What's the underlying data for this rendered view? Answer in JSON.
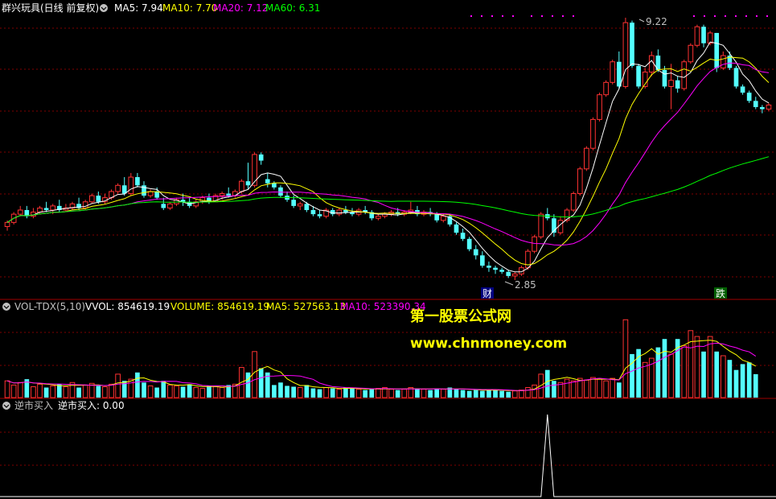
{
  "panels": {
    "main": {
      "title": "群兴玩具(日线 前复权)",
      "indicators": [
        {
          "label": "MA5: 7.94",
          "color": "#ffffff"
        },
        {
          "label": "MA10: 7.70",
          "color": "#ffff00"
        },
        {
          "label": "MA20: 7.12",
          "color": "#ff00ff"
        },
        {
          "label": "MA60: 6.31",
          "color": "#00ff00"
        }
      ],
      "high_label": "9.22",
      "low_label": "2.85",
      "markers": {
        "finance": "财",
        "drop": "跌"
      }
    },
    "volume": {
      "title": "VOL-TDX(5,10)",
      "indicators": [
        {
          "label": "VVOL: 854619.19",
          "color": "#ffffff"
        },
        {
          "label": "VOLUME: 854619.19",
          "color": "#ffff00"
        },
        {
          "label": "MA5: 527563.13",
          "color": "#ffff00"
        },
        {
          "label": "MA10: 523390.34",
          "color": "#ff00ff"
        }
      ]
    },
    "signal": {
      "title": "逆市买入",
      "indicators": [
        {
          "label": "逆市买入: 0.00",
          "color": "#ffffff"
        }
      ]
    }
  },
  "watermark": {
    "line1": "第一股票公式网",
    "line2": "www.chnmoney.com"
  },
  "colors": {
    "up": "#ff3232",
    "down": "#54ffff",
    "ma5": "#ffffff",
    "ma10": "#ffff00",
    "ma20": "#ff00ff",
    "ma60": "#00ff00",
    "grid": "#800000",
    "panel_border": "#a00000",
    "watermark": "#ffff00"
  },
  "chart_data": {
    "type": "candlestick",
    "price_range": [
      2.85,
      9.22
    ],
    "candles": [
      {
        "o": 4.15,
        "h": 4.3,
        "l": 4.05,
        "c": 4.25
      },
      {
        "o": 4.25,
        "h": 4.5,
        "l": 4.2,
        "c": 4.45
      },
      {
        "o": 4.45,
        "h": 4.65,
        "l": 4.4,
        "c": 4.55
      },
      {
        "o": 4.55,
        "h": 4.65,
        "l": 4.35,
        "c": 4.4
      },
      {
        "o": 4.4,
        "h": 4.6,
        "l": 4.35,
        "c": 4.5
      },
      {
        "o": 4.5,
        "h": 4.65,
        "l": 4.45,
        "c": 4.6
      },
      {
        "o": 4.6,
        "h": 4.75,
        "l": 4.5,
        "c": 4.55
      },
      {
        "o": 4.55,
        "h": 4.7,
        "l": 4.45,
        "c": 4.65
      },
      {
        "o": 4.65,
        "h": 4.8,
        "l": 4.5,
        "c": 4.55
      },
      {
        "o": 4.55,
        "h": 4.7,
        "l": 4.5,
        "c": 4.6
      },
      {
        "o": 4.6,
        "h": 4.75,
        "l": 4.55,
        "c": 4.7
      },
      {
        "o": 4.7,
        "h": 4.85,
        "l": 4.55,
        "c": 4.6
      },
      {
        "o": 4.6,
        "h": 4.8,
        "l": 4.55,
        "c": 4.75
      },
      {
        "o": 4.75,
        "h": 4.95,
        "l": 4.7,
        "c": 4.9
      },
      {
        "o": 4.9,
        "h": 5.0,
        "l": 4.7,
        "c": 4.75
      },
      {
        "o": 4.75,
        "h": 4.95,
        "l": 4.7,
        "c": 4.85
      },
      {
        "o": 4.85,
        "h": 5.05,
        "l": 4.8,
        "c": 5.0
      },
      {
        "o": 5.0,
        "h": 5.2,
        "l": 4.95,
        "c": 5.15
      },
      {
        "o": 5.15,
        "h": 5.35,
        "l": 4.9,
        "c": 4.95
      },
      {
        "o": 4.95,
        "h": 5.45,
        "l": 4.9,
        "c": 5.35
      },
      {
        "o": 5.35,
        "h": 5.45,
        "l": 5.1,
        "c": 5.15
      },
      {
        "o": 5.15,
        "h": 5.25,
        "l": 4.85,
        "c": 4.9
      },
      {
        "o": 4.9,
        "h": 5.05,
        "l": 4.85,
        "c": 5.0
      },
      {
        "o": 5.0,
        "h": 5.1,
        "l": 4.8,
        "c": 4.85
      },
      {
        "o": 4.7,
        "h": 4.85,
        "l": 4.55,
        "c": 4.6
      },
      {
        "o": 4.6,
        "h": 4.75,
        "l": 4.55,
        "c": 4.7
      },
      {
        "o": 4.7,
        "h": 4.85,
        "l": 4.65,
        "c": 4.8
      },
      {
        "o": 4.8,
        "h": 4.95,
        "l": 4.65,
        "c": 4.75
      },
      {
        "o": 4.75,
        "h": 4.85,
        "l": 4.6,
        "c": 4.65
      },
      {
        "o": 4.65,
        "h": 4.8,
        "l": 4.6,
        "c": 4.75
      },
      {
        "o": 4.75,
        "h": 4.9,
        "l": 4.7,
        "c": 4.85
      },
      {
        "o": 4.85,
        "h": 4.95,
        "l": 4.7,
        "c": 4.75
      },
      {
        "o": 4.75,
        "h": 4.95,
        "l": 4.75,
        "c": 4.9
      },
      {
        "o": 4.9,
        "h": 5.0,
        "l": 4.8,
        "c": 4.95
      },
      {
        "o": 4.95,
        "h": 5.1,
        "l": 4.85,
        "c": 4.9
      },
      {
        "o": 4.9,
        "h": 5.05,
        "l": 4.85,
        "c": 5.0
      },
      {
        "o": 5.0,
        "h": 5.3,
        "l": 4.95,
        "c": 5.25
      },
      {
        "o": 5.25,
        "h": 5.7,
        "l": 5.05,
        "c": 5.15
      },
      {
        "o": 5.15,
        "h": 5.95,
        "l": 5.1,
        "c": 5.9
      },
      {
        "o": 5.9,
        "h": 5.95,
        "l": 5.65,
        "c": 5.75
      },
      {
        "o": 5.3,
        "h": 5.45,
        "l": 5.1,
        "c": 5.2
      },
      {
        "o": 5.2,
        "h": 5.25,
        "l": 5.05,
        "c": 5.1
      },
      {
        "o": 5.1,
        "h": 5.15,
        "l": 4.85,
        "c": 4.9
      },
      {
        "o": 4.9,
        "h": 5.0,
        "l": 4.75,
        "c": 4.8
      },
      {
        "o": 4.8,
        "h": 4.9,
        "l": 4.6,
        "c": 4.65
      },
      {
        "o": 4.65,
        "h": 4.75,
        "l": 4.55,
        "c": 4.7
      },
      {
        "o": 4.7,
        "h": 4.75,
        "l": 4.5,
        "c": 4.55
      },
      {
        "o": 4.55,
        "h": 4.65,
        "l": 4.4,
        "c": 4.45
      },
      {
        "o": 4.45,
        "h": 4.55,
        "l": 4.35,
        "c": 4.4
      },
      {
        "o": 4.4,
        "h": 4.6,
        "l": 4.35,
        "c": 4.55
      },
      {
        "o": 4.55,
        "h": 4.6,
        "l": 4.4,
        "c": 4.45
      },
      {
        "o": 4.45,
        "h": 4.6,
        "l": 4.4,
        "c": 4.55
      },
      {
        "o": 4.55,
        "h": 4.65,
        "l": 4.45,
        "c": 4.5
      },
      {
        "o": 4.5,
        "h": 4.6,
        "l": 4.4,
        "c": 4.45
      },
      {
        "o": 4.45,
        "h": 4.6,
        "l": 4.4,
        "c": 4.55
      },
      {
        "o": 4.55,
        "h": 4.65,
        "l": 4.45,
        "c": 4.5
      },
      {
        "o": 4.5,
        "h": 4.55,
        "l": 4.3,
        "c": 4.35
      },
      {
        "o": 4.35,
        "h": 4.45,
        "l": 4.3,
        "c": 4.4
      },
      {
        "o": 4.4,
        "h": 4.5,
        "l": 4.35,
        "c": 4.45
      },
      {
        "o": 4.45,
        "h": 4.55,
        "l": 4.4,
        "c": 4.5
      },
      {
        "o": 4.5,
        "h": 4.6,
        "l": 4.4,
        "c": 4.45
      },
      {
        "o": 4.45,
        "h": 4.55,
        "l": 4.4,
        "c": 4.5
      },
      {
        "o": 4.5,
        "h": 4.75,
        "l": 4.45,
        "c": 4.55
      },
      {
        "o": 4.55,
        "h": 4.65,
        "l": 4.4,
        "c": 4.45
      },
      {
        "o": 4.45,
        "h": 4.55,
        "l": 4.4,
        "c": 4.5
      },
      {
        "o": 4.5,
        "h": 4.6,
        "l": 4.4,
        "c": 4.45
      },
      {
        "o": 4.45,
        "h": 4.5,
        "l": 4.25,
        "c": 4.3
      },
      {
        "o": 4.3,
        "h": 4.45,
        "l": 4.25,
        "c": 4.4
      },
      {
        "o": 4.4,
        "h": 4.45,
        "l": 4.15,
        "c": 4.2
      },
      {
        "o": 4.2,
        "h": 4.25,
        "l": 3.95,
        "c": 4.0
      },
      {
        "o": 4.0,
        "h": 4.1,
        "l": 3.8,
        "c": 3.85
      },
      {
        "o": 3.85,
        "h": 3.9,
        "l": 3.55,
        "c": 3.6
      },
      {
        "o": 3.6,
        "h": 3.7,
        "l": 3.35,
        "c": 3.45
      },
      {
        "o": 3.45,
        "h": 3.55,
        "l": 3.15,
        "c": 3.2
      },
      {
        "o": 3.2,
        "h": 3.3,
        "l": 3.05,
        "c": 3.15
      },
      {
        "o": 3.15,
        "h": 3.2,
        "l": 3.0,
        "c": 3.1
      },
      {
        "o": 3.1,
        "h": 3.15,
        "l": 3.0,
        "c": 3.05
      },
      {
        "o": 3.05,
        "h": 3.1,
        "l": 2.9,
        "c": 2.95
      },
      {
        "o": 2.95,
        "h": 3.05,
        "l": 2.85,
        "c": 3.0
      },
      {
        "o": 3.0,
        "h": 3.2,
        "l": 2.95,
        "c": 3.15
      },
      {
        "o": 3.15,
        "h": 3.6,
        "l": 3.1,
        "c": 3.55
      },
      {
        "o": 3.55,
        "h": 3.95,
        "l": 3.5,
        "c": 3.9
      },
      {
        "o": 3.9,
        "h": 4.5,
        "l": 3.85,
        "c": 4.45
      },
      {
        "o": 4.45,
        "h": 4.6,
        "l": 4.3,
        "c": 4.35
      },
      {
        "o": 4.35,
        "h": 4.45,
        "l": 3.9,
        "c": 4.0
      },
      {
        "o": 4.0,
        "h": 4.4,
        "l": 3.95,
        "c": 4.3
      },
      {
        "o": 4.3,
        "h": 4.6,
        "l": 4.25,
        "c": 4.55
      },
      {
        "o": 4.55,
        "h": 5.0,
        "l": 4.5,
        "c": 4.95
      },
      {
        "o": 4.95,
        "h": 5.6,
        "l": 4.9,
        "c": 5.55
      },
      {
        "o": 5.55,
        "h": 6.1,
        "l": 5.5,
        "c": 6.05
      },
      {
        "o": 6.05,
        "h": 6.8,
        "l": 6.0,
        "c": 6.75
      },
      {
        "o": 6.75,
        "h": 7.4,
        "l": 6.7,
        "c": 7.35
      },
      {
        "o": 7.35,
        "h": 7.7,
        "l": 7.3,
        "c": 7.65
      },
      {
        "o": 7.65,
        "h": 8.2,
        "l": 7.6,
        "c": 8.15
      },
      {
        "o": 8.15,
        "h": 8.4,
        "l": 7.5,
        "c": 7.55
      },
      {
        "o": 7.55,
        "h": 9.22,
        "l": 7.5,
        "c": 9.1
      },
      {
        "o": 9.1,
        "h": 9.15,
        "l": 8.0,
        "c": 8.05
      },
      {
        "o": 8.05,
        "h": 8.1,
        "l": 7.5,
        "c": 7.55
      },
      {
        "o": 7.55,
        "h": 8.0,
        "l": 7.5,
        "c": 7.9
      },
      {
        "o": 7.9,
        "h": 8.4,
        "l": 7.8,
        "c": 8.3
      },
      {
        "o": 8.3,
        "h": 8.45,
        "l": 7.9,
        "c": 7.95
      },
      {
        "o": 7.95,
        "h": 8.05,
        "l": 7.5,
        "c": 7.55
      },
      {
        "o": 7.55,
        "h": 8.1,
        "l": 7.0,
        "c": 7.7
      },
      {
        "o": 7.7,
        "h": 7.8,
        "l": 7.4,
        "c": 7.5
      },
      {
        "o": 7.5,
        "h": 8.2,
        "l": 7.45,
        "c": 8.15
      },
      {
        "o": 8.15,
        "h": 8.6,
        "l": 8.1,
        "c": 8.55
      },
      {
        "o": 8.55,
        "h": 9.05,
        "l": 8.5,
        "c": 9.0
      },
      {
        "o": 9.0,
        "h": 9.05,
        "l": 8.5,
        "c": 8.6
      },
      {
        "o": 8.6,
        "h": 8.9,
        "l": 8.55,
        "c": 8.85
      },
      {
        "o": 8.85,
        "h": 8.85,
        "l": 7.9,
        "c": 8.0
      },
      {
        "o": 8.0,
        "h": 8.4,
        "l": 7.95,
        "c": 8.3
      },
      {
        "o": 8.3,
        "h": 8.4,
        "l": 7.95,
        "c": 8.0
      },
      {
        "o": 8.0,
        "h": 8.05,
        "l": 7.5,
        "c": 7.55
      },
      {
        "o": 7.55,
        "h": 7.6,
        "l": 7.35,
        "c": 7.4
      },
      {
        "o": 7.4,
        "h": 7.45,
        "l": 7.15,
        "c": 7.2
      },
      {
        "o": 7.2,
        "h": 7.3,
        "l": 7.0,
        "c": 7.05
      },
      {
        "o": 7.05,
        "h": 7.1,
        "l": 6.9,
        "c": 7.0
      },
      {
        "o": 7.0,
        "h": 7.15,
        "l": 6.95,
        "c": 7.1
      }
    ],
    "volumes": [
      0.2,
      0.15,
      0.18,
      0.22,
      0.13,
      0.16,
      0.12,
      0.14,
      0.16,
      0.13,
      0.18,
      0.12,
      0.15,
      0.17,
      0.14,
      0.13,
      0.16,
      0.28,
      0.2,
      0.22,
      0.3,
      0.18,
      0.14,
      0.12,
      0.2,
      0.15,
      0.14,
      0.13,
      0.16,
      0.12,
      0.11,
      0.14,
      0.13,
      0.12,
      0.15,
      0.16,
      0.36,
      0.3,
      0.55,
      0.35,
      0.3,
      0.15,
      0.18,
      0.14,
      0.13,
      0.12,
      0.15,
      0.11,
      0.1,
      0.12,
      0.11,
      0.1,
      0.12,
      0.11,
      0.1,
      0.09,
      0.1,
      0.11,
      0.12,
      0.1,
      0.09,
      0.1,
      0.12,
      0.11,
      0.1,
      0.09,
      0.11,
      0.1,
      0.12,
      0.1,
      0.09,
      0.08,
      0.09,
      0.08,
      0.1,
      0.09,
      0.08,
      0.07,
      0.08,
      0.09,
      0.12,
      0.15,
      0.28,
      0.33,
      0.2,
      0.18,
      0.22,
      0.2,
      0.23,
      0.21,
      0.24,
      0.22,
      0.2,
      0.23,
      0.18,
      0.93,
      0.52,
      0.58,
      0.42,
      0.47,
      0.6,
      0.7,
      0.52,
      0.7,
      0.62,
      0.8,
      0.73,
      0.55,
      0.73,
      0.55,
      0.5,
      0.45,
      0.33,
      0.4,
      0.42,
      0.28
    ],
    "volume_max": 1.0,
    "signal": {
      "peak_index": 83,
      "value": 1.0
    }
  }
}
